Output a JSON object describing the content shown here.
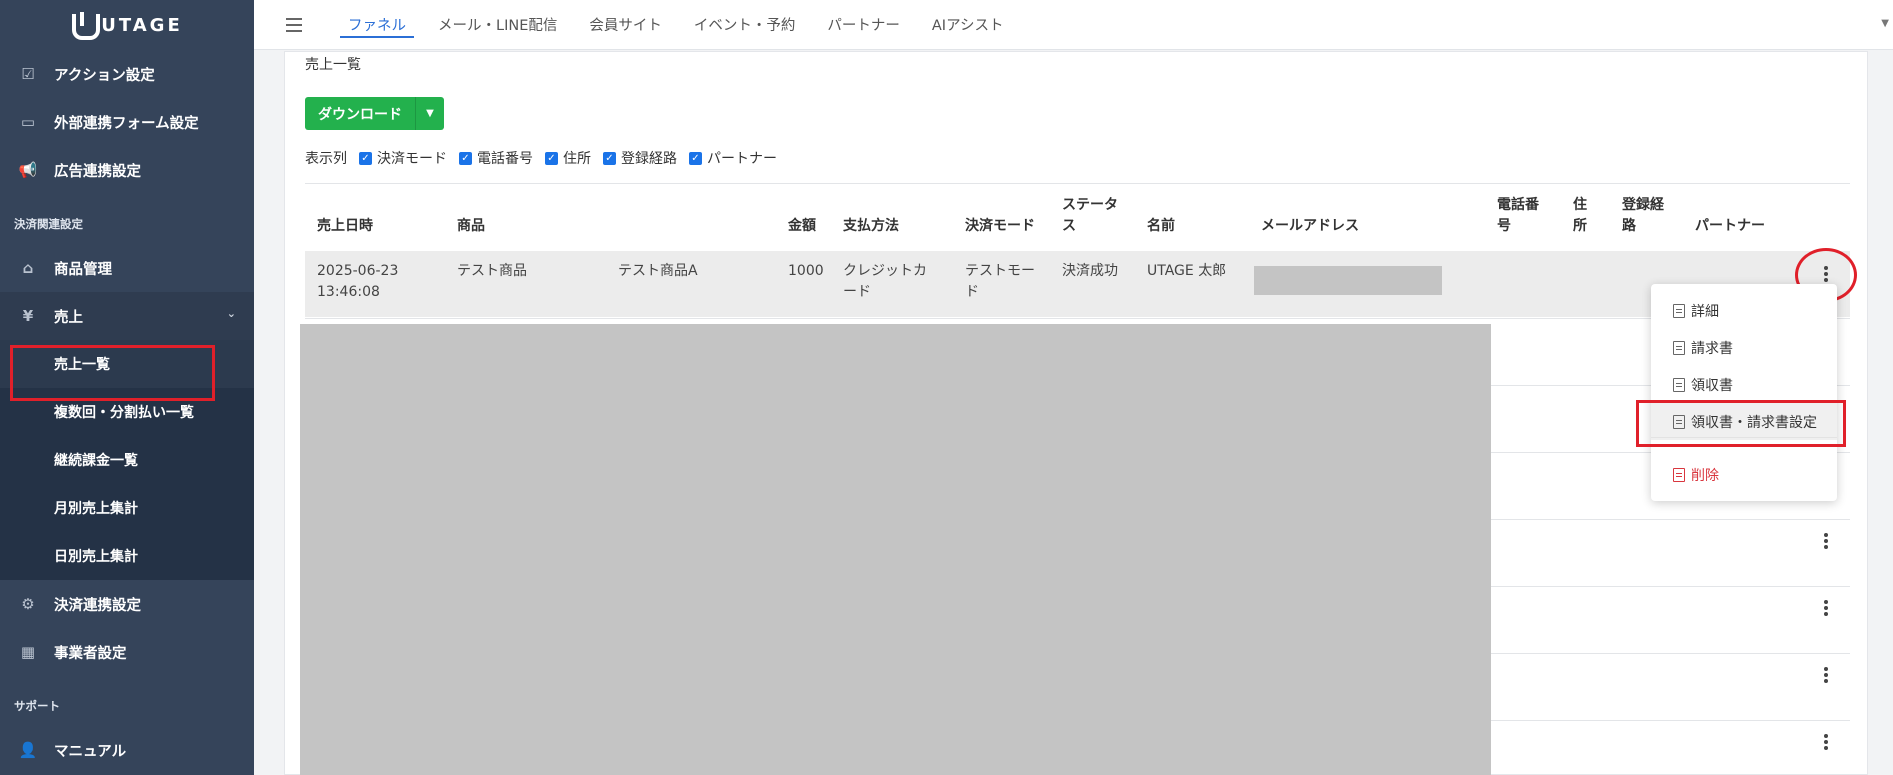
{
  "app": {
    "logo_text": "UTAGE"
  },
  "sidebar": {
    "items_top": [
      {
        "label": "アクション設定",
        "icon": "checkbox-icon"
      },
      {
        "label": "外部連携フォーム設定",
        "icon": "form-icon"
      },
      {
        "label": "広告連携設定",
        "icon": "megaphone-icon"
      }
    ],
    "section_payment": "決済関連設定",
    "item_products": "商品管理",
    "item_sales": "売上",
    "sales_sub": [
      "売上一覧",
      "複数回・分割払い一覧",
      "継続課金一覧",
      "月別売上集計",
      "日別売上集計"
    ],
    "item_payment_integration": "決済連携設定",
    "item_business": "事業者設定",
    "section_support": "サポート",
    "item_manual": "マニュアル"
  },
  "topnav": {
    "tabs": [
      "ファネル",
      "メール・LINE配信",
      "会員サイト",
      "イベント・予約",
      "パートナー",
      "AIアシスト"
    ],
    "active_index": 0
  },
  "main": {
    "title": "売上一覧",
    "download_label": "ダウンロード",
    "columns_label": "表示列",
    "column_toggles": [
      "決済モード",
      "電話番号",
      "住所",
      "登録経路",
      "パートナー"
    ],
    "table_headers": {
      "date": "売上日時",
      "product": "商品",
      "amount": "金額",
      "payment_method": "支払方法",
      "payment_mode": "決済モード",
      "status_1": "ステータ",
      "status_2": "ス",
      "name": "名前",
      "email": "メールアドレス",
      "phone_1": "電話番",
      "phone_2": "号",
      "address_1": "住",
      "address_2": "所",
      "route_1": "登録経",
      "route_2": "路",
      "partner": "パートナー"
    },
    "row1": {
      "date_1": "2025-06-23",
      "date_2": "13:46:08",
      "product": "テスト商品",
      "product_variant": "テスト商品A",
      "amount": "1000",
      "method_1": "クレジットカ",
      "method_2": "ード",
      "mode_1": "テストモー",
      "mode_2": "ド",
      "status": "決済成功",
      "name": "UTAGE 太郎"
    }
  },
  "row_menu": {
    "items": [
      "詳細",
      "請求書",
      "領収書",
      "領収書・請求書設定"
    ],
    "delete_label": "削除"
  },
  "colors": {
    "accent": "#2b6fd6",
    "download": "#23b14d",
    "highlight": "#e0202a",
    "sidebar": "#35445a"
  }
}
